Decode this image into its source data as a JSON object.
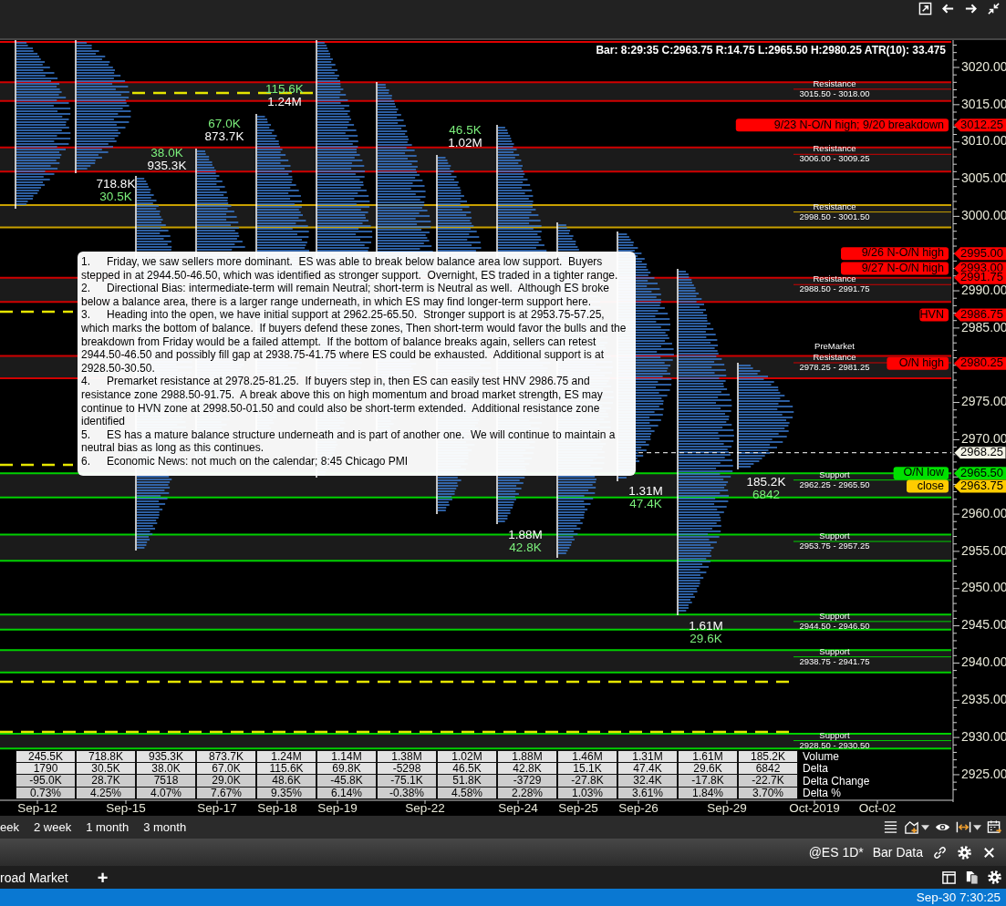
{
  "bar_info": "Bar: 8:29:35 C:2963.75 R:14.75 L:2965.50 H:2980.25 ATR(10): 33.475",
  "price_axis": {
    "labels": [
      "3020.00",
      "3015.00",
      "3010.00",
      "3005.00",
      "3000.00",
      "2990.00",
      "2985.00",
      "2975.00",
      "2970.00",
      "2960.00",
      "2955.00",
      "2950.00",
      "2945.00",
      "2940.00",
      "2935.00",
      "2930.00",
      "2925.00"
    ]
  },
  "zones": [
    {
      "label": "Resistance",
      "range": "3015.50 - 3018.00",
      "color": "#d00000"
    },
    {
      "label": "Resistance",
      "range": "3006.00 - 3009.25",
      "color": "#d00000"
    },
    {
      "label": "Resistance",
      "range": "2998.50 - 3001.50",
      "color": "#c8a000"
    },
    {
      "label": "Resistance",
      "range": "2988.50 - 2991.75",
      "color": "#d00000"
    },
    {
      "label": "Resistance",
      "range": "2978.25 - 2981.25",
      "color": "#d00000",
      "note": "PreMarket"
    },
    {
      "label": "Support",
      "range": "2962.25 - 2965.50",
      "color": "#00d000"
    },
    {
      "label": "Support",
      "range": "2953.75 - 2957.25",
      "color": "#00d000"
    },
    {
      "label": "Support",
      "range": "2944.50 - 2946.50",
      "color": "#00d000"
    },
    {
      "label": "Support",
      "range": "2938.75 - 2941.75",
      "color": "#00d000"
    },
    {
      "label": "Support",
      "range": "2928.50 - 2930.50",
      "color": "#00d000"
    }
  ],
  "price_tags": [
    {
      "label": "9/23 N-O/N high; 9/20 breakdown",
      "value": "3012.25",
      "color": "#ff0000",
      "current": false
    },
    {
      "label": "9/26 N-O/N high",
      "value": "2995.00",
      "color": "#ff0000",
      "current": false
    },
    {
      "label": "9/27 N-O/N high",
      "value": "2993.00",
      "color": "#ff0000",
      "current": false
    },
    {
      "value": "2991.75",
      "color": "#ff0000",
      "current": false
    },
    {
      "label": "HVN",
      "value": "2986.75",
      "color": "#ff0000",
      "current": false
    },
    {
      "label": "O/N high",
      "value": "2980.25",
      "color": "#ff0000",
      "current": false
    },
    {
      "value": "2968.25",
      "color": "#f4f4e6",
      "current": true
    },
    {
      "label": "O/N low",
      "value": "2965.50",
      "color": "#00e000",
      "current": false
    },
    {
      "label": "close",
      "value": "2963.75",
      "color": "#ffcc00",
      "current": false
    }
  ],
  "chart_labels": [
    {
      "lines": [
        {
          "kind": "volume",
          "text": "718.8K"
        },
        {
          "kind": "delta",
          "text": "30.5K"
        }
      ]
    },
    {
      "lines": [
        {
          "kind": "delta",
          "text": "38.0K"
        },
        {
          "kind": "volume",
          "text": "935.3K"
        }
      ]
    },
    {
      "lines": [
        {
          "kind": "delta",
          "text": "67.0K"
        },
        {
          "kind": "volume",
          "text": "873.7K"
        }
      ]
    },
    {
      "lines": [
        {
          "kind": "delta",
          "text": "115.6K"
        },
        {
          "kind": "volume",
          "text": "1.24M"
        }
      ]
    },
    {
      "lines": [
        {
          "kind": "delta",
          "text": "46.5K"
        },
        {
          "kind": "volume",
          "text": "1.02M"
        }
      ]
    },
    {
      "lines": [
        {
          "kind": "volume",
          "text": "1.88M"
        },
        {
          "kind": "delta",
          "text": "42.8K"
        }
      ]
    },
    {
      "lines": [
        {
          "kind": "volume",
          "text": "1.31M"
        },
        {
          "kind": "delta",
          "text": "47.4K"
        }
      ]
    },
    {
      "lines": [
        {
          "kind": "volume",
          "text": "1.61M"
        },
        {
          "kind": "delta",
          "text": "29.6K"
        }
      ]
    },
    {
      "lines": [
        {
          "kind": "volume",
          "text": "185.2K"
        },
        {
          "kind": "delta",
          "text": "6842"
        }
      ]
    }
  ],
  "notes": [
    {
      "number": "1.",
      "text": "Friday, we saw sellers more dominant.  ES was able to break below balance area low support.  Buyers stepped in at 2944.50-46.50, which was identified as stronger support.  Overnight, ES traded in a tighter range."
    },
    {
      "number": "2.",
      "text": "Directional Bias: intermediate-term will remain Neutral; short-term is Neutral as well.  Although ES broke below a balance area, there is a larger range underneath, in which ES may find longer-term support here."
    },
    {
      "number": "3.",
      "text": "Heading into the open, we have initial support at 2962.25-65.50.  Stronger support is at 2953.75-57.25, which marks the bottom of balance.  If buyers defend these zones, Then short-term would favor the bulls and the breakdown from Friday would be a failed attempt.  If the bottom of balance breaks again, sellers can retest 2944.50-46.50 and possibly fill gap at 2938.75-41.75 where ES could be exhausted.  Additional support is at 2928.50-30.50."
    },
    {
      "number": "4.",
      "text": "Premarket resistance at 2978.25-81.25.  If buyers step in, then ES can easily test HNV 2986.75 and resistance zone 2988.50-91.75.  A break above this on high momentum and broad market strength, ES may continue to HVN zone at 2998.50-01.50 and could also be short-term extended.  Additional resistance zone identified"
    },
    {
      "number": "5.",
      "text": "ES has a mature balance structure underneath and is part of another one.  We will continue to maintain a neutral bias as long as this continues."
    },
    {
      "number": "6.",
      "text": "Economic News: not much on the calendar; 8:45 Chicago PMI"
    }
  ],
  "table": {
    "rows": [
      {
        "label": "Volume",
        "cells": [
          "245.5K",
          "718.8K",
          "935.3K",
          "873.7K",
          "1.24M",
          "1.14M",
          "1.38M",
          "1.02M",
          "1.88M",
          "1.46M",
          "1.31M",
          "1.61M",
          "185.2K"
        ]
      },
      {
        "label": "Delta",
        "cells": [
          "1790",
          "30.5K",
          "38.0K",
          "67.0K",
          "115.6K",
          "69.8K",
          "-5298",
          "46.5K",
          "42.8K",
          "15.1K",
          "47.4K",
          "29.6K",
          "6842"
        ]
      },
      {
        "label": "Delta Change",
        "cells": [
          "-95.0K",
          "28.7K",
          "7518",
          "29.0K",
          "48.6K",
          "-45.8K",
          "-75.1K",
          "51.8K",
          "-3729",
          "-27.8K",
          "32.4K",
          "-17.8K",
          "-22.7K"
        ]
      },
      {
        "label": "Delta %",
        "cells": [
          "0.73%",
          "4.25%",
          "4.07%",
          "7.67%",
          "9.35%",
          "6.14%",
          "-0.38%",
          "4.58%",
          "2.28%",
          "1.03%",
          "3.61%",
          "1.84%",
          "3.70%"
        ]
      }
    ]
  },
  "dates": [
    "Sep-12",
    "Sep-15",
    "Sep-17",
    "Sep-18",
    "Sep-19",
    "Sep-22",
    "Sep-24",
    "Sep-25",
    "Sep-26",
    "Sep-29",
    "Oct-2019",
    "Oct-02"
  ],
  "timeframes": [
    "eek",
    "2 week",
    "1 month",
    "3 month"
  ],
  "panel_header": {
    "symbol": "@ES 1D*",
    "view": "Bar Data"
  },
  "tabs": [
    {
      "label": "road Market"
    }
  ],
  "add_tab": "+",
  "status_bar": {
    "time": "Sep-30 7:30:25"
  }
}
